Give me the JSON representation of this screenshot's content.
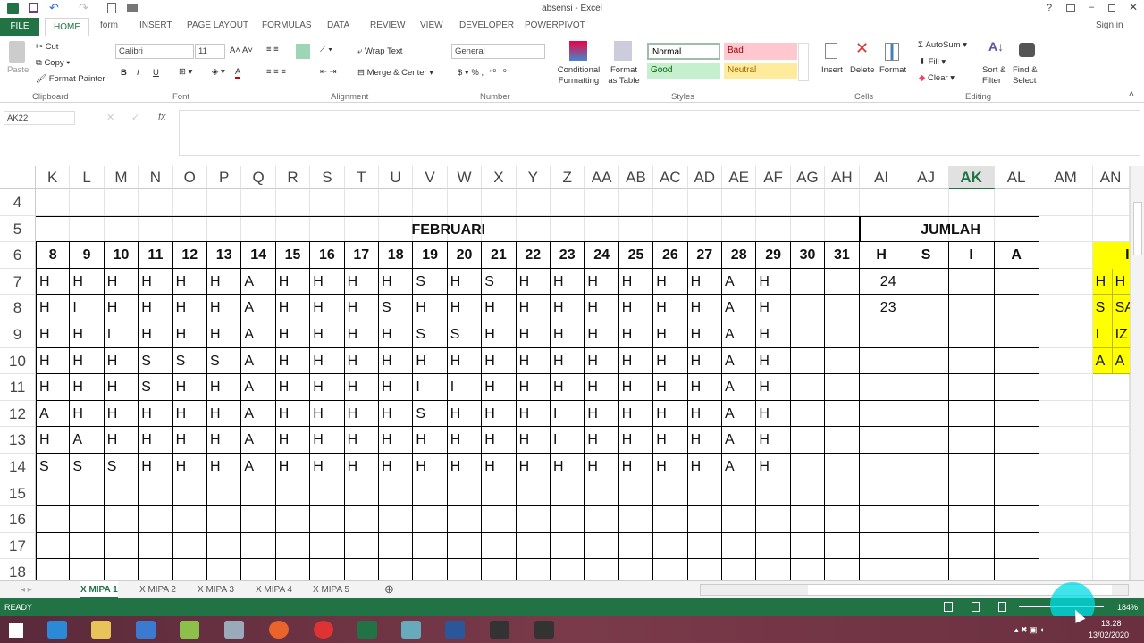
{
  "window": {
    "title": "absensi - Excel",
    "sign_in": "Sign in"
  },
  "ribbon_tabs": [
    "FILE",
    "HOME",
    "form",
    "INSERT",
    "PAGE LAYOUT",
    "FORMULAS",
    "DATA",
    "REVIEW",
    "VIEW",
    "DEVELOPER",
    "POWERPIVOT"
  ],
  "active_tab": "HOME",
  "clipboard": {
    "paste": "Paste",
    "cut": "Cut",
    "copy": "Copy",
    "format_painter": "Format Painter",
    "group": "Clipboard"
  },
  "font": {
    "name": "Calibri",
    "size": "11",
    "bold": "B",
    "italic": "I",
    "underline": "U",
    "group": "Font"
  },
  "alignment": {
    "wrap": "Wrap Text",
    "merge": "Merge & Center",
    "group": "Alignment"
  },
  "number": {
    "format": "General",
    "currency": "$",
    "percent": "%",
    "comma": ",",
    "group": "Number"
  },
  "styles": {
    "conditional": "Conditional Formatting",
    "format_table": "Format as Table",
    "normal": "Normal",
    "bad": "Bad",
    "good": "Good",
    "neutral": "Neutral",
    "group": "Styles"
  },
  "cells": {
    "insert": "Insert",
    "delete": "Delete",
    "format": "Format",
    "group": "Cells"
  },
  "editing": {
    "autosum": "AutoSum",
    "fill": "Fill",
    "clear": "Clear",
    "sort": "Sort & Filter",
    "find": "Find & Select",
    "group": "Editing"
  },
  "name_box": "AK22",
  "formula": "",
  "columns": [
    "K",
    "L",
    "M",
    "N",
    "O",
    "P",
    "Q",
    "R",
    "S",
    "T",
    "U",
    "V",
    "W",
    "X",
    "Y",
    "Z",
    "AA",
    "AB",
    "AC",
    "AD",
    "AE",
    "AF",
    "AG",
    "AH",
    "AI",
    "AJ",
    "AK",
    "AL",
    "AM",
    "AN"
  ],
  "selected_column": "AK",
  "rows": [
    4,
    5,
    6,
    7,
    8,
    9,
    10,
    11,
    12,
    13,
    14,
    15,
    16,
    17,
    18
  ],
  "month_header": "FEBRUARI",
  "total_header": "JUMLAH",
  "days": [
    "8",
    "9",
    "10",
    "11",
    "12",
    "13",
    "14",
    "15",
    "16",
    "17",
    "18",
    "19",
    "20",
    "21",
    "22",
    "23",
    "24",
    "25",
    "26",
    "27",
    "28",
    "29",
    "30",
    "31"
  ],
  "total_cols": [
    "H",
    "S",
    "I",
    "A"
  ],
  "attendance": [
    [
      "H",
      "H",
      "H",
      "H",
      "H",
      "H",
      "A",
      "H",
      "H",
      "H",
      "H",
      "S",
      "H",
      "S",
      "H",
      "H",
      "H",
      "H",
      "H",
      "H",
      "A",
      "H"
    ],
    [
      "H",
      "I",
      "H",
      "H",
      "H",
      "H",
      "A",
      "H",
      "H",
      "H",
      "S",
      "H",
      "H",
      "H",
      "H",
      "H",
      "H",
      "H",
      "H",
      "H",
      "A",
      "H"
    ],
    [
      "H",
      "H",
      "I",
      "H",
      "H",
      "H",
      "A",
      "H",
      "H",
      "H",
      "H",
      "S",
      "S",
      "H",
      "H",
      "H",
      "H",
      "H",
      "H",
      "H",
      "A",
      "H"
    ],
    [
      "H",
      "H",
      "H",
      "S",
      "S",
      "S",
      "A",
      "H",
      "H",
      "H",
      "H",
      "H",
      "H",
      "H",
      "H",
      "H",
      "H",
      "H",
      "H",
      "H",
      "A",
      "H"
    ],
    [
      "H",
      "H",
      "H",
      "S",
      "H",
      "H",
      "A",
      "H",
      "H",
      "H",
      "H",
      "I",
      "I",
      "H",
      "H",
      "H",
      "H",
      "H",
      "H",
      "H",
      "A",
      "H"
    ],
    [
      "A",
      "H",
      "H",
      "H",
      "H",
      "H",
      "A",
      "H",
      "H",
      "H",
      "H",
      "S",
      "H",
      "H",
      "H",
      "I",
      "H",
      "H",
      "H",
      "H",
      "A",
      "H"
    ],
    [
      "H",
      "A",
      "H",
      "H",
      "H",
      "H",
      "A",
      "H",
      "H",
      "H",
      "H",
      "H",
      "H",
      "H",
      "H",
      "I",
      "H",
      "H",
      "H",
      "H",
      "A",
      "H"
    ],
    [
      "S",
      "S",
      "S",
      "H",
      "H",
      "H",
      "A",
      "H",
      "H",
      "H",
      "H",
      "H",
      "H",
      "H",
      "H",
      "H",
      "H",
      "H",
      "H",
      "H",
      "A",
      "H"
    ]
  ],
  "totals_h": [
    "24",
    "23",
    "",
    "",
    "",
    "",
    "",
    ""
  ],
  "legend": {
    "header": "I",
    "rows": [
      [
        "H",
        "H"
      ],
      [
        "S",
        "SA"
      ],
      [
        "I",
        "IZ"
      ],
      [
        "A",
        "A"
      ]
    ],
    "color": "#ffff00"
  },
  "sheet_tabs": [
    "X MIPA 1",
    "X MIPA 2",
    "X MIPA 3",
    "X MIPA 4",
    "X MIPA 5"
  ],
  "active_sheet": "X MIPA 1",
  "status": {
    "ready": "READY",
    "zoom": "184%"
  },
  "clock": {
    "time": "13:28",
    "date": "13/02/2020"
  },
  "colors": {
    "excel_green": "#217346",
    "selected_header": "#217346"
  }
}
